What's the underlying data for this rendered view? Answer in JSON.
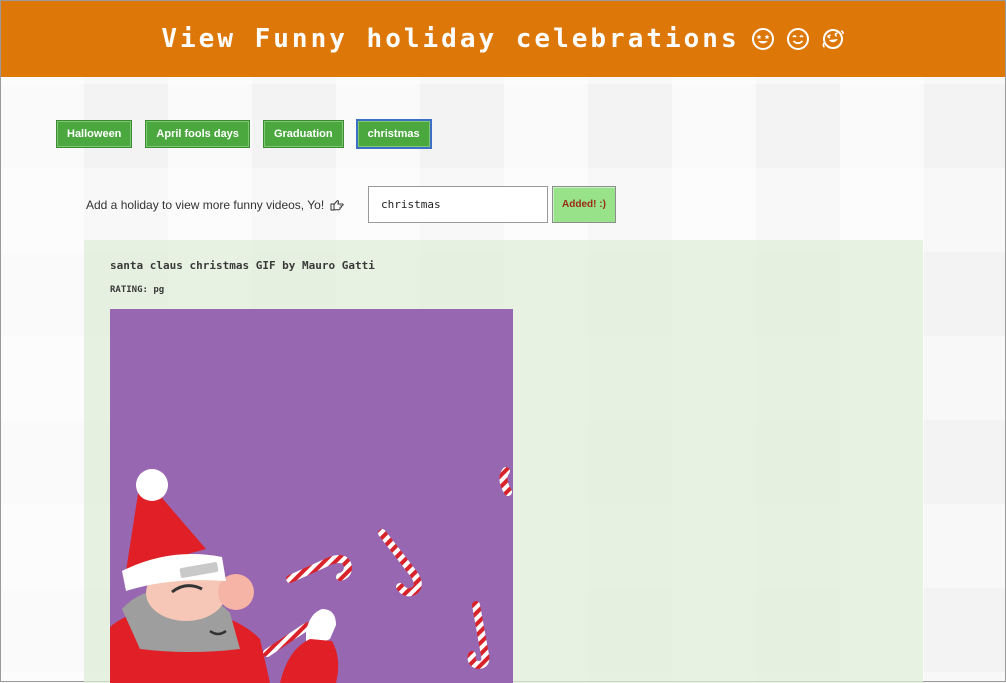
{
  "header": {
    "title": "View Funny holiday celebrations",
    "emojis": [
      "star-eyes-emoji-icon",
      "smile-emoji-icon",
      "laughing-emoji-icon"
    ]
  },
  "holiday_buttons": [
    {
      "label": "Halloween",
      "active": false
    },
    {
      "label": "April fools days",
      "active": false
    },
    {
      "label": "Graduation",
      "active": false
    },
    {
      "label": "christmas",
      "active": true
    }
  ],
  "add_form": {
    "prompt": "Add a holiday to view more funny videos, Yo!",
    "input_value": "christmas",
    "submit_label": "Added! :)"
  },
  "results": [
    {
      "title": "santa claus christmas GIF by Mauro Gatti",
      "rating": "RATING: pg"
    }
  ],
  "colors": {
    "header_bg": "#dd7707",
    "button_bg": "#4ba83f",
    "added_button_bg": "#98e38a",
    "gif_bg": "#9867b1"
  }
}
